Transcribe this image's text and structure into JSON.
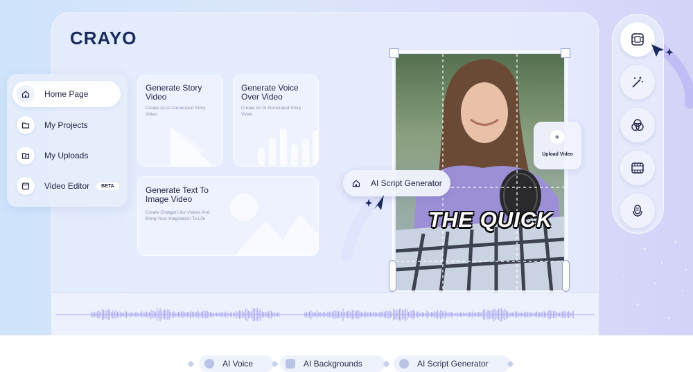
{
  "brand": {
    "logo": "CRAYO"
  },
  "sidebar": {
    "items": [
      {
        "label": "Home Page",
        "icon": "home-icon",
        "active": true
      },
      {
        "label": "My Projects",
        "icon": "folder-icon",
        "active": false
      },
      {
        "label": "My Uploads",
        "icon": "upload-folder-icon",
        "active": false
      },
      {
        "label": "Video Editor",
        "icon": "video-editor-icon",
        "active": false,
        "badge": "BETA"
      }
    ]
  },
  "cards": [
    {
      "title": "Generate Story Video",
      "desc": "Create An AI-Generated Story Video"
    },
    {
      "title": "Generate Voice Over Video",
      "desc": "Create An AI-Generated Story Video"
    },
    {
      "title": "Generate Text To Image Video",
      "desc": "Create Chatgpt Like Videos And Bring Your Imagination To Life"
    }
  ],
  "preview": {
    "caption": "THE QUICK",
    "ai_pill": "AI Script Generator",
    "upload": {
      "label": "Upload Video",
      "icon": "plus-icon"
    }
  },
  "toolbar": {
    "tools": [
      "film-frame-icon",
      "magic-wand-icon",
      "color-filter-icon",
      "film-strip-icon",
      "microphone-icon"
    ]
  },
  "features": [
    "AI Voice",
    "AI Backgrounds",
    "AI Script Generator"
  ],
  "colors": {
    "brand": "#1a2a5c",
    "accent": "#7b7fe6",
    "waveform": "#a9a6f0"
  }
}
